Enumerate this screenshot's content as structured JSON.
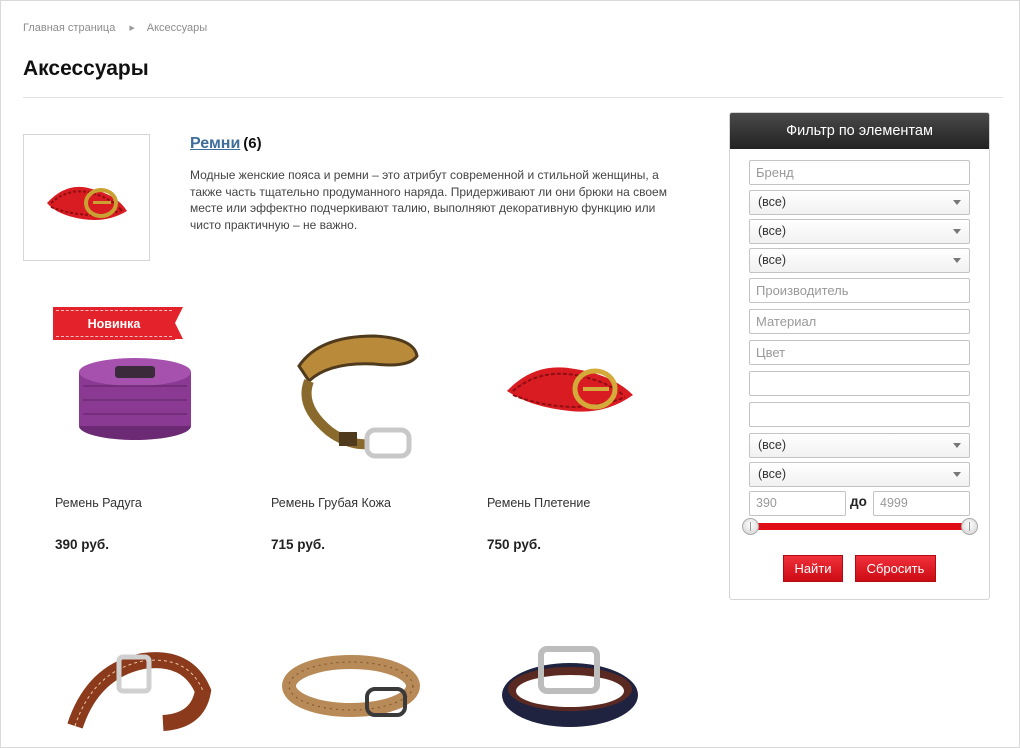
{
  "breadcrumbs": {
    "home": "Главная страница",
    "current": "Аксессуары"
  },
  "page_title": "Аксессуары",
  "category": {
    "title": "Ремни",
    "count": "(6)",
    "description": "Модные женские пояса и ремни – это атрибут современной и стильной женщины, а также часть тщательно продуманного наряда. Придерживают ли они брюки на своем месте или эффектно подчеркивают талию, выполняют декоративную функцию или чисто практичную – не важно."
  },
  "badge_new": "Новинка",
  "products": [
    {
      "name": "Ремень Радуга",
      "price": "390 руб."
    },
    {
      "name": "Ремень Грубая Кожа",
      "price": "715 руб."
    },
    {
      "name": "Ремень Плетение",
      "price": "750 руб."
    }
  ],
  "filter": {
    "title": "Фильтр по элементам",
    "brand_placeholder": "Бренд",
    "select_all": "(все)",
    "maker_placeholder": "Производитель",
    "material_placeholder": "Материал",
    "color_placeholder": "Цвет",
    "range_from": "390",
    "range_to": "4999",
    "range_sep": "до",
    "find_label": "Найти",
    "reset_label": "Сбросить"
  },
  "colors": {
    "accent": "#e3222b",
    "link": "#3d6d9b",
    "header_dark": "#2a2a2a"
  }
}
